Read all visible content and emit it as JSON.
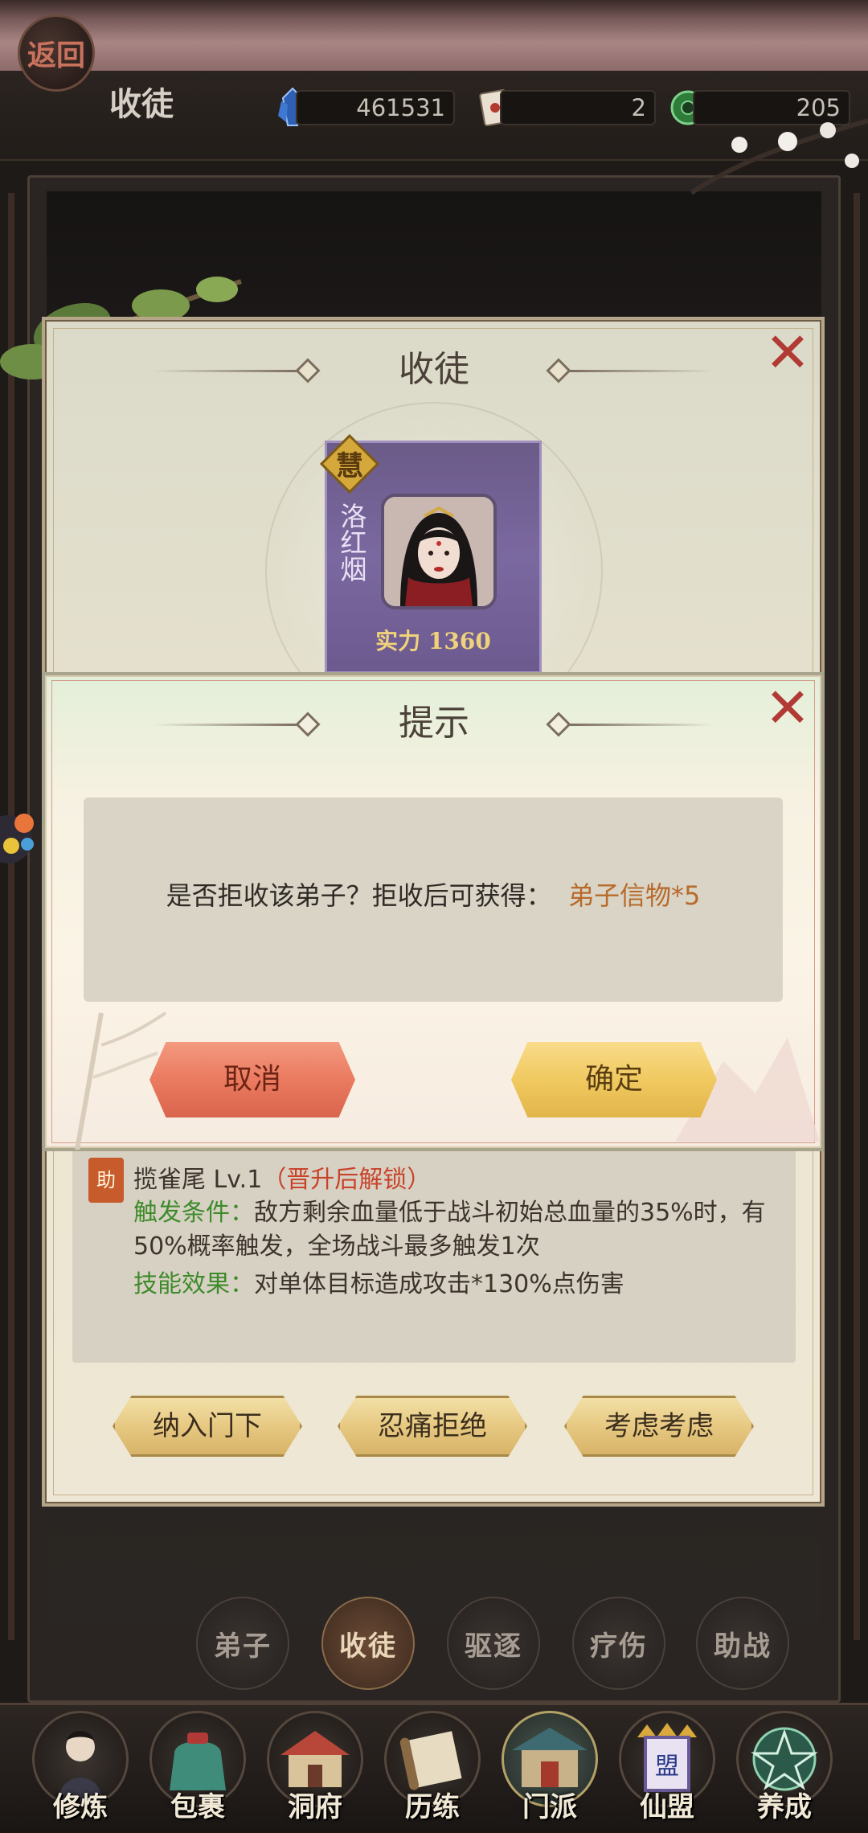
{
  "header": {
    "back_label": "返回",
    "title": "收徒",
    "resources": [
      {
        "icon": "spirit-crystal-icon",
        "value": "461531"
      },
      {
        "icon": "letter-token-icon",
        "value": "2"
      },
      {
        "icon": "jade-coin-icon",
        "value": "205"
      }
    ]
  },
  "main_dialog": {
    "title": "收徒",
    "disciple": {
      "badge": "慧",
      "name": "洛红烟",
      "power_label": "实力 1360"
    },
    "skill": {
      "badge": "助",
      "name": "揽雀尾 Lv.1",
      "lock_note": "（晋升后解锁）",
      "condition_label": "触发条件：",
      "condition_text": "敌方剩余血量低于战斗初始总血量的35%时，有50%概率触发，全场战斗最多触发1次",
      "effect_label": "技能效果：",
      "effect_text": "对单体目标造成攻击*130%点伤害"
    },
    "actions": [
      "纳入门下",
      "忍痛拒绝",
      "考虑考虑"
    ]
  },
  "confirm_dialog": {
    "title": "提示",
    "message": "是否拒收该弟子？拒收后可获得：",
    "reward": "弟子信物*5",
    "cancel_label": "取消",
    "confirm_label": "确定"
  },
  "sub_tabs": [
    {
      "label": "弟子",
      "active": false
    },
    {
      "label": "收徒",
      "active": true
    },
    {
      "label": "驱逐",
      "active": false
    },
    {
      "label": "疗伤",
      "active": false
    },
    {
      "label": "助战",
      "active": false
    }
  ],
  "bottom_nav": [
    {
      "label": "修炼",
      "icon": "cultivator-icon"
    },
    {
      "label": "包裹",
      "icon": "bag-icon"
    },
    {
      "label": "洞府",
      "icon": "mansion-icon"
    },
    {
      "label": "历练",
      "icon": "scroll-icon"
    },
    {
      "label": "门派",
      "icon": "sect-gate-icon",
      "active": true
    },
    {
      "label": "仙盟",
      "icon": "alliance-banner-icon"
    },
    {
      "label": "养成",
      "icon": "pentagram-icon"
    }
  ],
  "colors": {
    "accent_red": "#b23a34",
    "reward_orange": "#b86a2b",
    "skill_green": "#3e8b2b"
  }
}
